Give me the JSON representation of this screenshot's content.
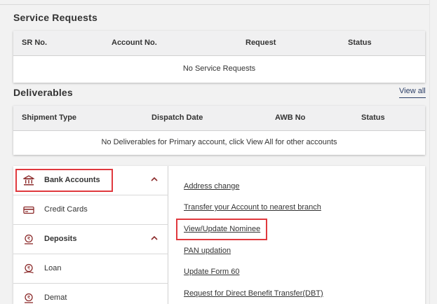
{
  "service_requests": {
    "title": "Service Requests",
    "columns": [
      "SR No.",
      "Account No.",
      "Request",
      "Status"
    ],
    "empty_message": "No Service Requests"
  },
  "deliverables": {
    "title": "Deliverables",
    "view_all": "View all",
    "columns": [
      "Shipment Type",
      "Dispatch Date",
      "AWB No",
      "Status"
    ],
    "empty_message": "No Deliverables for Primary account, click View All for other accounts"
  },
  "menu": {
    "items": [
      {
        "label": "Bank Accounts",
        "icon": "bank-icon",
        "expanded": true
      },
      {
        "label": "Credit Cards",
        "icon": "credit-card-icon"
      },
      {
        "label": "Deposits",
        "icon": "deposit-icon",
        "expanded": true
      },
      {
        "label": "Loan",
        "icon": "loan-icon"
      },
      {
        "label": "Demat",
        "icon": "demat-icon"
      }
    ]
  },
  "links": [
    "Address change",
    "Transfer your Account to nearest branch",
    "View/Update Nominee",
    "PAN updation",
    "Update Form 60",
    "Request for Direct Benefit Transfer(DBT)"
  ],
  "colors": {
    "accent": "#8b2a2a",
    "highlight": "#e0393e",
    "link": "#2b3e66",
    "header_bg": "#f0f0f1"
  }
}
